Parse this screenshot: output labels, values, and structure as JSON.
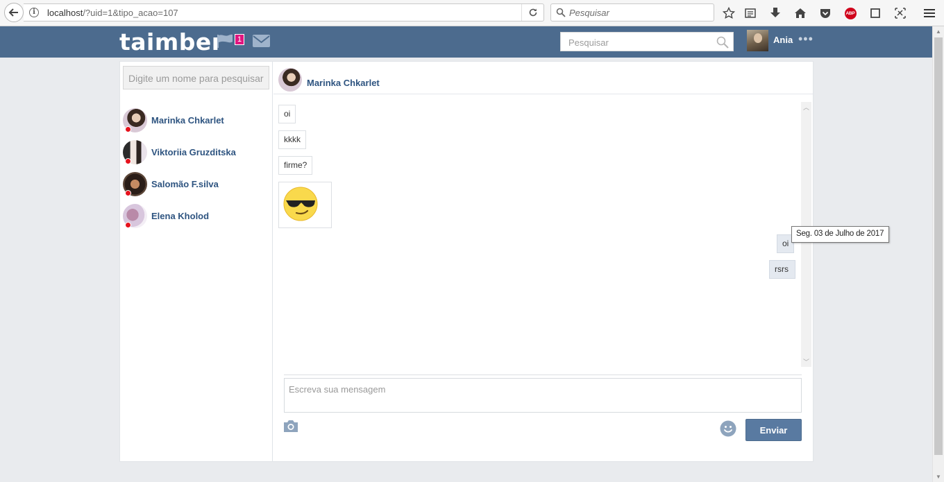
{
  "browser": {
    "url_host": "localhost",
    "url_path": "/?uid=1&tipo_acao=107",
    "search_placeholder": "Pesquisar",
    "abp_label": "ABP"
  },
  "header": {
    "logo": "taimber",
    "notification_count": "1",
    "search_placeholder": "Pesquisar",
    "user_name": "Ania",
    "more_label": "•••"
  },
  "sidebar": {
    "search_placeholder": "Digite um nome para pesquisar",
    "contacts": [
      {
        "name": "Marinka Chkarlet",
        "status_color": "#e6121d"
      },
      {
        "name": "Viktoriia Gruzditska",
        "status_color": "#e6121d"
      },
      {
        "name": "Salomão F.silva",
        "status_color": "#e6121d"
      },
      {
        "name": "Elena Kholod",
        "status_color": "#e6121d"
      }
    ]
  },
  "chat": {
    "contact_name": "Marinka Chkarlet",
    "messages_received": [
      "oi",
      "kkkk",
      "firme?"
    ],
    "sticker": "sunglasses-smiley",
    "messages_sent": [
      "oi",
      "rsrs"
    ],
    "tooltip": "Seg. 03 de Julho de 2017",
    "compose_placeholder": "Escreva sua mensagem",
    "send_label": "Enviar"
  },
  "colors": {
    "header_bg": "#4c6b8e",
    "link": "#2e5480",
    "badge": "#e0157f",
    "send_button": "#597aa1",
    "offline_dot": "#e6121d"
  }
}
